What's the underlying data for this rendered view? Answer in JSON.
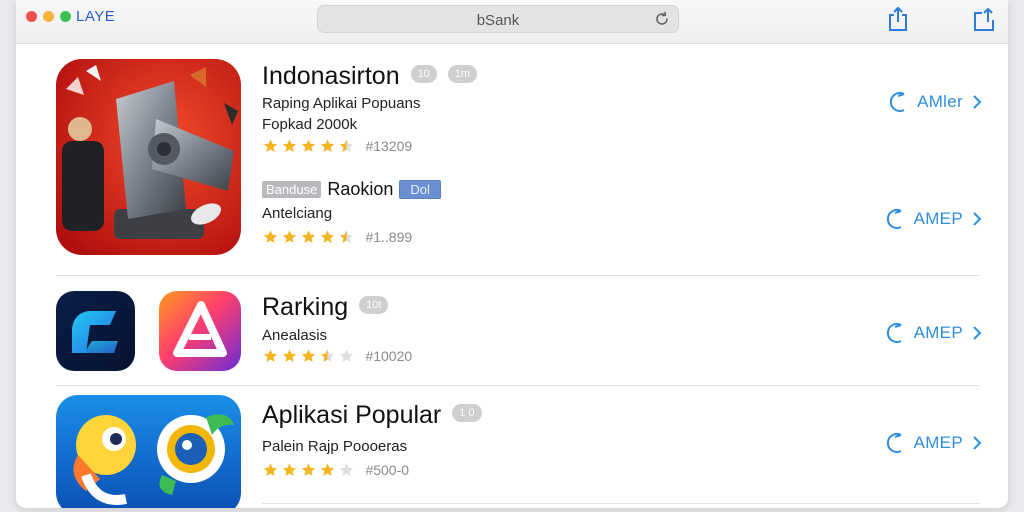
{
  "window": {
    "app_title": "LAYE",
    "address": "bSank"
  },
  "toolbar": {
    "icons": [
      "share-icon",
      "export-icon",
      "reload-icon"
    ]
  },
  "colors": {
    "accent": "#2f8ee0",
    "star": "#f4b521",
    "star_empty": "#dedee2"
  },
  "apps": [
    {
      "title": "Indonasirton",
      "pills": [
        "10",
        "1m"
      ],
      "subtitle_1": "Raping Aplikai Popuans",
      "subtitle_2": "Fopkad 2000k",
      "stars": 4.5,
      "rating_count": "#13209",
      "action": "AMler"
    },
    {
      "badge_grey": "Banduse",
      "title": "Raokion",
      "badge_blue": "Dol",
      "subtitle_1": "Antelciang",
      "stars": 4.5,
      "rating_count": "#1..899",
      "action": "AMEP"
    },
    {
      "title": "Rarking",
      "pills": [
        "10t"
      ],
      "subtitle_1": "Anealasis",
      "stars": 3.5,
      "rating_count": "#10020",
      "action": "AMEP"
    },
    {
      "title": "Aplikasi Popular",
      "pills": [
        "1 0"
      ],
      "subtitle_1": "Palein Rajp Poooeras",
      "stars": 4,
      "rating_count": "#500-0",
      "action": "AMEP"
    }
  ]
}
